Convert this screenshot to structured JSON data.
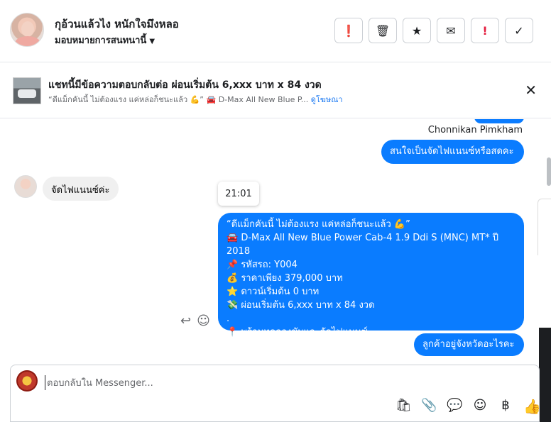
{
  "header": {
    "contact_name": "กุอ้วนแล้วไง หนักใจมึงหลอ",
    "assign_label": "มอบหมายการสนทนานี้",
    "buttons": {
      "info": "❗",
      "delete": "🗑",
      "star": "★",
      "mail": "✉",
      "spam": "!",
      "done": "✓"
    }
  },
  "ad": {
    "title": "แชทนี้มีข้อความตอบกลับต่อ ผ่อนเริ่มต้น 6,xxx บาท x 84 งวด",
    "subtitle": "“ดีแม็กคันนี้ ไม่ต้องแรง แค่หล่อก็ชนะแล้ว 💪” 🚘 D-Max All New Blue P...",
    "view_ad": "ดูโฆษณา",
    "close": "✕"
  },
  "messages": {
    "sender_name": "Chonnikan Pimkham",
    "out1": "สนใจเป็นจัดไฟแนนซ์หรือสดคะ",
    "in1": "จัดไฟแนนซ์ค่ะ",
    "time": "21:01",
    "out2": "“ดีแม็กคันนี้ ไม่ต้องแรง แค่หล่อก็ชนะแล้ว 💪”\n🚘 D-Max All New Blue Power Cab-4 1.9 Ddi S (MNC) MT* ปี 2018\n📌 รหัสรถ: Y004\n💰 ราคาเพียง 379,000 บาท\n⭐ ดาวน์เริ่มต้น 0 บาท\n💸 ผ่อนเริ่มต้น 6,xxx บาท x 84 งวด\n.\n📍 พร้อมทดลองขับและจัดไฟแนนซ์",
    "out3": "ลูกค้าอยู่จังหวัดอะไรคะ"
  },
  "composer": {
    "placeholder": "ตอบกลับใน Messenger...",
    "tools": {
      "bag": "🛍",
      "attach": "📎",
      "saved_reply": "💬",
      "emoji": "☺",
      "baht": "฿",
      "like": "👍"
    }
  },
  "icons": [
    "info-icon",
    "trash-icon",
    "star-icon",
    "mail-icon",
    "spam-icon",
    "check-icon",
    "close-icon",
    "reply-icon",
    "emoji-icon",
    "bag-icon",
    "attach-icon",
    "saved-reply-icon",
    "baht-icon",
    "like-icon"
  ],
  "colors": {
    "accent": "#0a7cff",
    "spam_red": "#e41e3f",
    "incoming_bg": "#f0f0f0"
  }
}
